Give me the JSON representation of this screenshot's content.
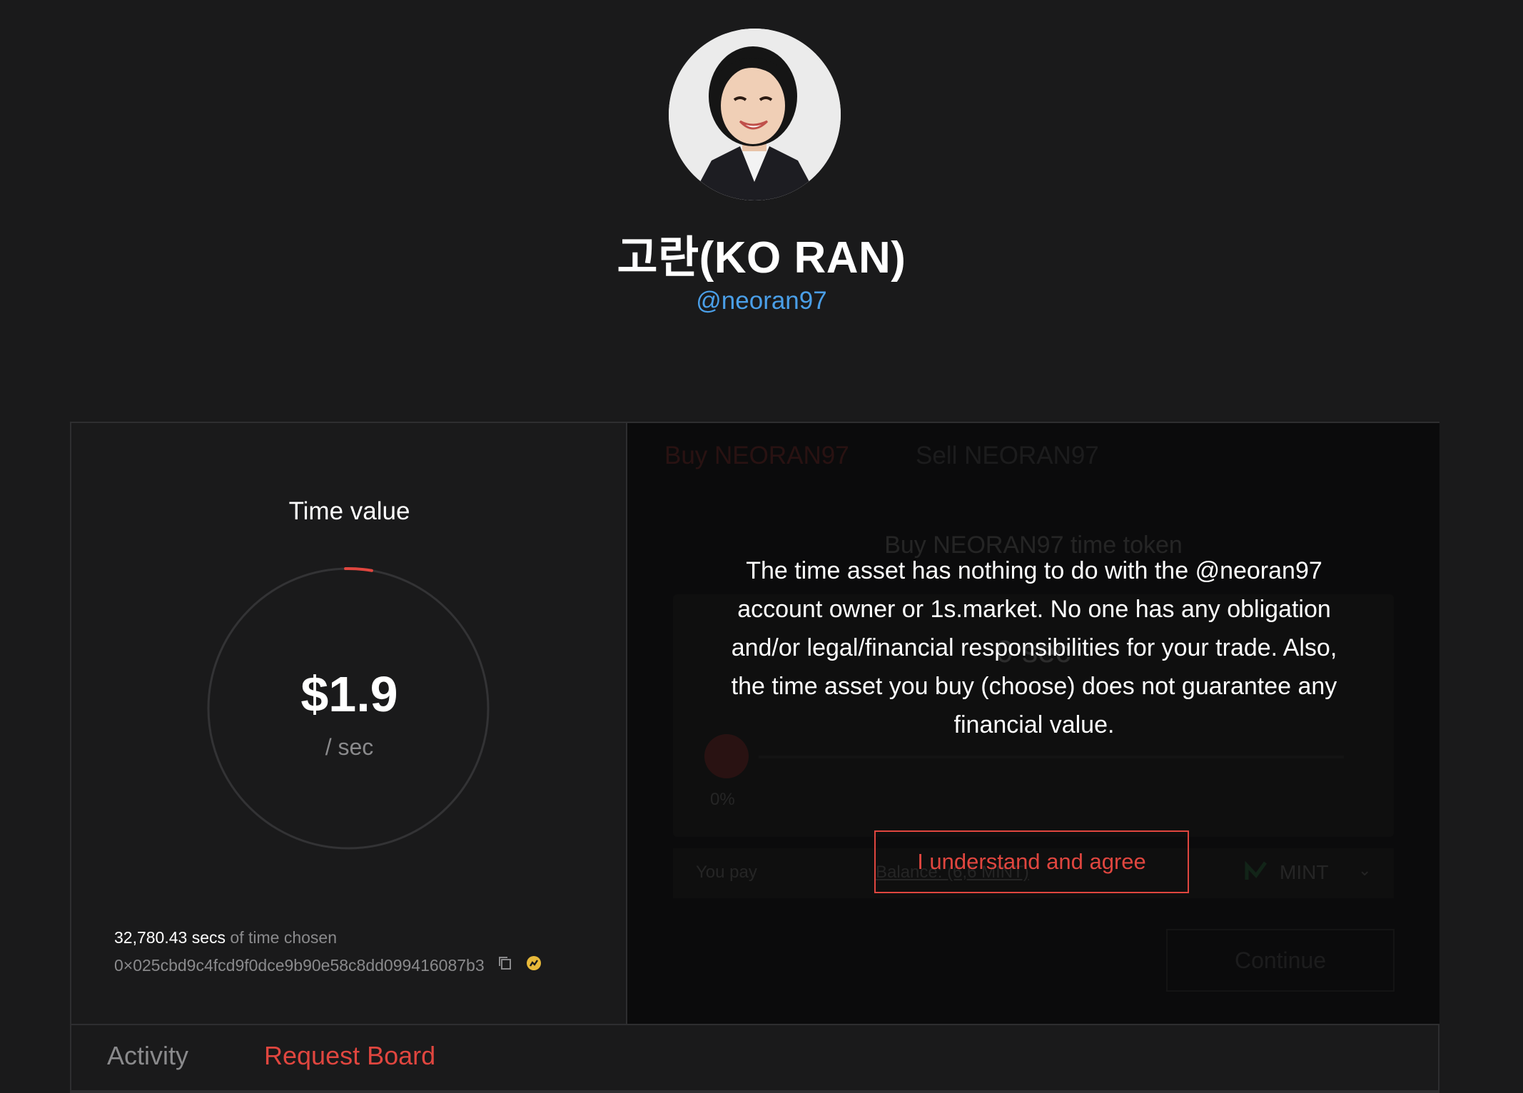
{
  "profile": {
    "name": "고란(KO RAN)",
    "handle": "@neoran97",
    "avatar_icon": "profile-photo"
  },
  "time_value": {
    "title": "Time value",
    "value": "$1.9",
    "unit": "/ sec",
    "gauge_progress": 0.03
  },
  "stats": {
    "secs": "32,780.43 secs",
    "secs_suffix": " of time chosen",
    "address": "0×025cbd9c4fcd9f0dce9b90e58c8dd099416087b3"
  },
  "trade": {
    "tab_buy": "Buy NEORAN97",
    "tab_sell": "Sell NEORAN97",
    "form_title": "Buy NEORAN97 time token",
    "slider_percent": "0%",
    "you_pay": "You pay",
    "balance": "Balance: (6,6 MINT)",
    "currency": "MINT",
    "continue": "Continue"
  },
  "modal": {
    "text": "The time asset has nothing to do with the @neoran97 account owner or 1s.market. No one has any obligation and/or legal/financial responsibilities for your trade. Also, the time asset you buy (choose) does not guarantee any financial value.",
    "agree": "I understand and agree"
  },
  "bottom_tabs": {
    "activity": "Activity",
    "request_board": "Request Board"
  },
  "colors": {
    "background": "#1a1a1b",
    "accent": "#e0463f",
    "handle": "#4a9fe8",
    "mint": "#3fbf6a"
  }
}
